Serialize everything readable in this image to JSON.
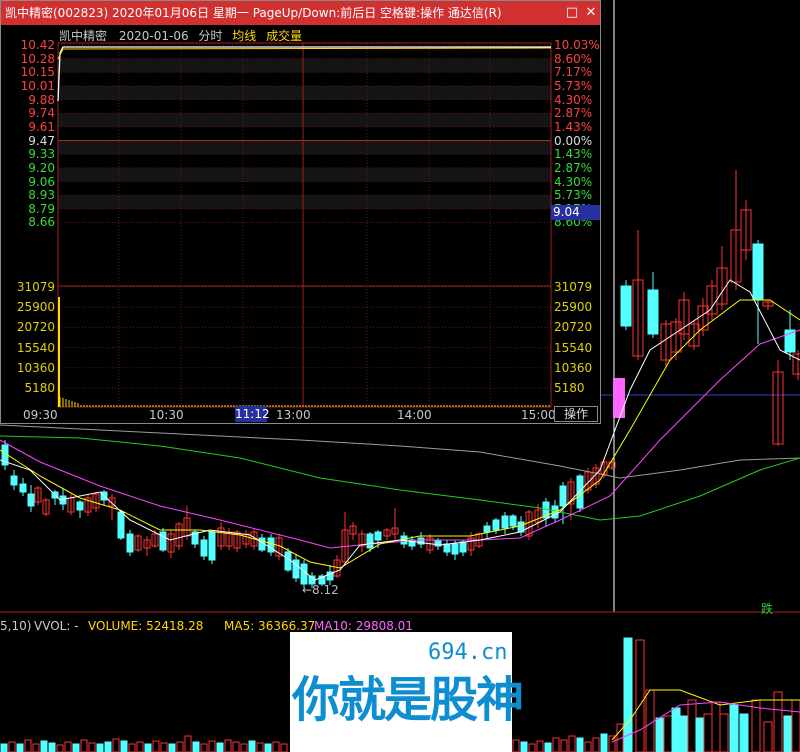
{
  "popup": {
    "title": "凯中精密(002823)  2020年01月06日  星期一  PageUp/Down:前后日  空格键:操作  通达信(R)",
    "minimize": "□",
    "close": "✕",
    "subhead": {
      "name": "凯中精密",
      "date": "2020-01-06",
      "mode": "分时",
      "avg_label": "均线",
      "vol_label": "成交量"
    },
    "price_left": [
      "10.42",
      "10.28",
      "10.15",
      "10.01",
      "9.88",
      "9.74",
      "9.61",
      "9.47",
      "9.33",
      "9.20",
      "9.06",
      "8.93",
      "8.79",
      "8.66"
    ],
    "price_right": [
      "10.03%",
      "8.60%",
      "7.17%",
      "5.73%",
      "4.30%",
      "2.87%",
      "1.43%",
      "0.00%",
      "1.43%",
      "2.87%",
      "4.30%",
      "5.73%",
      "7.17%",
      "8.60%"
    ],
    "volume_ticks": [
      "31079",
      "25900",
      "20720",
      "15540",
      "10360",
      "5180"
    ],
    "times": [
      "09:30",
      "10:30",
      "11:12",
      "13:00",
      "14:00",
      "15:00"
    ],
    "current_time": "11:12",
    "current_price": "9.04",
    "operate_button": "操作"
  },
  "chart": {
    "low_marker": "←8.12",
    "die_label": "跌",
    "vol_header": {
      "param": "5,10)",
      "vvol": "VVOL: -",
      "volume": "VOLUME: 52418.28",
      "ma5": "MA5: 36366.37",
      "ma10": "MA10: 29808.01"
    }
  },
  "watermark": {
    "url": "694.cn",
    "text": "你就是股神"
  },
  "colors": {
    "up": "#ff3333",
    "down": "#54ffff",
    "ma5": "#ffffff",
    "ma10": "#ffff00",
    "ma20": "#ff40ff",
    "ma60": "#00e000",
    "title_bar": "#d03030"
  }
}
